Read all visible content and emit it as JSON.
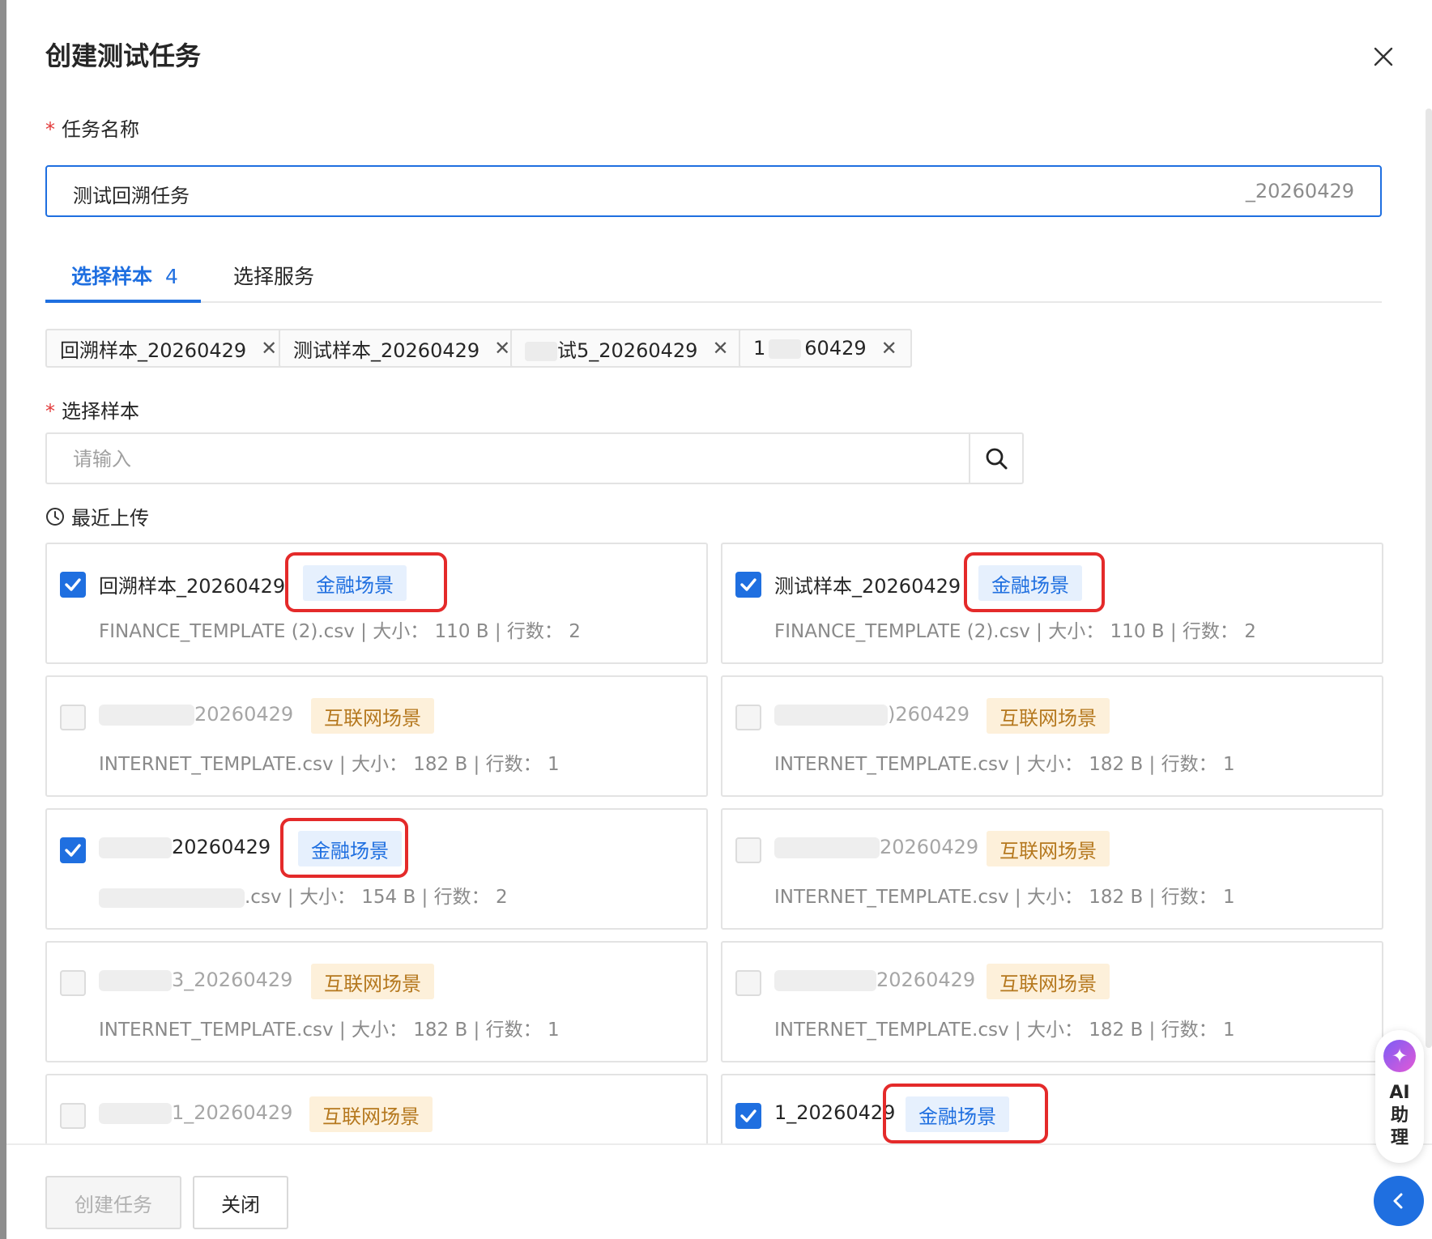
{
  "modal": {
    "title": "创建测试任务"
  },
  "task_name": {
    "required_mark": "*",
    "label": "任务名称",
    "value": "测试回溯任务",
    "suffix": "_20260429"
  },
  "tabs": [
    {
      "label": "选择样本",
      "count": "4",
      "active": true
    },
    {
      "label": "选择服务",
      "active": false
    }
  ],
  "selected_chips": [
    {
      "label": "回溯样本_20260429"
    },
    {
      "label": "测试样本_20260429"
    },
    {
      "label": "试5_20260429"
    },
    {
      "label_prefix": "1",
      "label": "60429"
    }
  ],
  "sample_select": {
    "required_mark": "*",
    "label": "选择样本",
    "placeholder": "请输入"
  },
  "recent": {
    "label": "最近上传"
  },
  "cards": [
    {
      "name": "回溯样本_20260429",
      "tag": "金融场景",
      "tag_type": "finance",
      "checked": true,
      "file": "FINANCE_TEMPLATE (2).csv",
      "size_label": "大小：",
      "size": "110 B",
      "rows_label": "行数：",
      "rows": "2",
      "highlighted": true
    },
    {
      "name": "测试样本_20260429",
      "tag": "金融场景",
      "tag_type": "finance",
      "checked": true,
      "file": "FINANCE_TEMPLATE (2).csv",
      "size_label": "大小：",
      "size": "110 B",
      "rows_label": "行数：",
      "rows": "2",
      "highlighted": true
    },
    {
      "name": "20260429",
      "tag": "互联网场景",
      "tag_type": "internet",
      "checked": false,
      "file": "INTERNET_TEMPLATE.csv",
      "size_label": "大小：",
      "size": "182 B",
      "rows_label": "行数：",
      "rows": "1",
      "highlighted": false
    },
    {
      "name": ")260429",
      "tag": "互联网场景",
      "tag_type": "internet",
      "checked": false,
      "file": "INTERNET_TEMPLATE.csv",
      "size_label": "大小：",
      "size": "182 B",
      "rows_label": "行数：",
      "rows": "1",
      "highlighted": false
    },
    {
      "name": "20260429",
      "tag": "金融场景",
      "tag_type": "finance",
      "checked": true,
      "file": ".csv",
      "size_label": "大小：",
      "size": "154 B",
      "rows_label": "行数：",
      "rows": "2",
      "highlighted": true
    },
    {
      "name": "20260429",
      "tag": "互联网场景",
      "tag_type": "internet",
      "checked": false,
      "file": "INTERNET_TEMPLATE.csv",
      "size_label": "大小：",
      "size": "182 B",
      "rows_label": "行数：",
      "rows": "1",
      "highlighted": false
    },
    {
      "name": "3_20260429",
      "tag": "互联网场景",
      "tag_type": "internet",
      "checked": false,
      "file": "INTERNET_TEMPLATE.csv",
      "size_label": "大小：",
      "size": "182 B",
      "rows_label": "行数：",
      "rows": "1",
      "highlighted": false
    },
    {
      "name": "20260429",
      "tag": "互联网场景",
      "tag_type": "internet",
      "checked": false,
      "file": "INTERNET_TEMPLATE.csv",
      "size_label": "大小：",
      "size": "182 B",
      "rows_label": "行数：",
      "rows": "1",
      "highlighted": false
    },
    {
      "name": "1_20260429",
      "tag": "互联网场景",
      "tag_type": "internet",
      "checked": false,
      "highlighted": false
    },
    {
      "name": "1_20260429",
      "tag": "金融场景",
      "tag_type": "finance",
      "checked": true,
      "highlighted": true
    }
  ],
  "footer": {
    "create_label": "创建任务",
    "close_label": "关闭"
  },
  "ai_assistant": {
    "label_chars": [
      "AI",
      "助",
      "理"
    ]
  },
  "colors": {
    "primary": "#1f6fe0",
    "finance_tag_bg": "#e6f0fd",
    "internet_tag_bg": "#fdf0da",
    "internet_tag_text": "#b5781e",
    "highlight_red": "#e42a2a",
    "required_red": "#e23b3b"
  },
  "icons": {
    "close": "close-icon",
    "search": "search-icon",
    "clock": "clock-icon",
    "check": "check-icon",
    "remove_chip": "remove-chip-icon",
    "ai_logo": "ai-logo-icon",
    "collapse": "chevron-left-icon"
  }
}
